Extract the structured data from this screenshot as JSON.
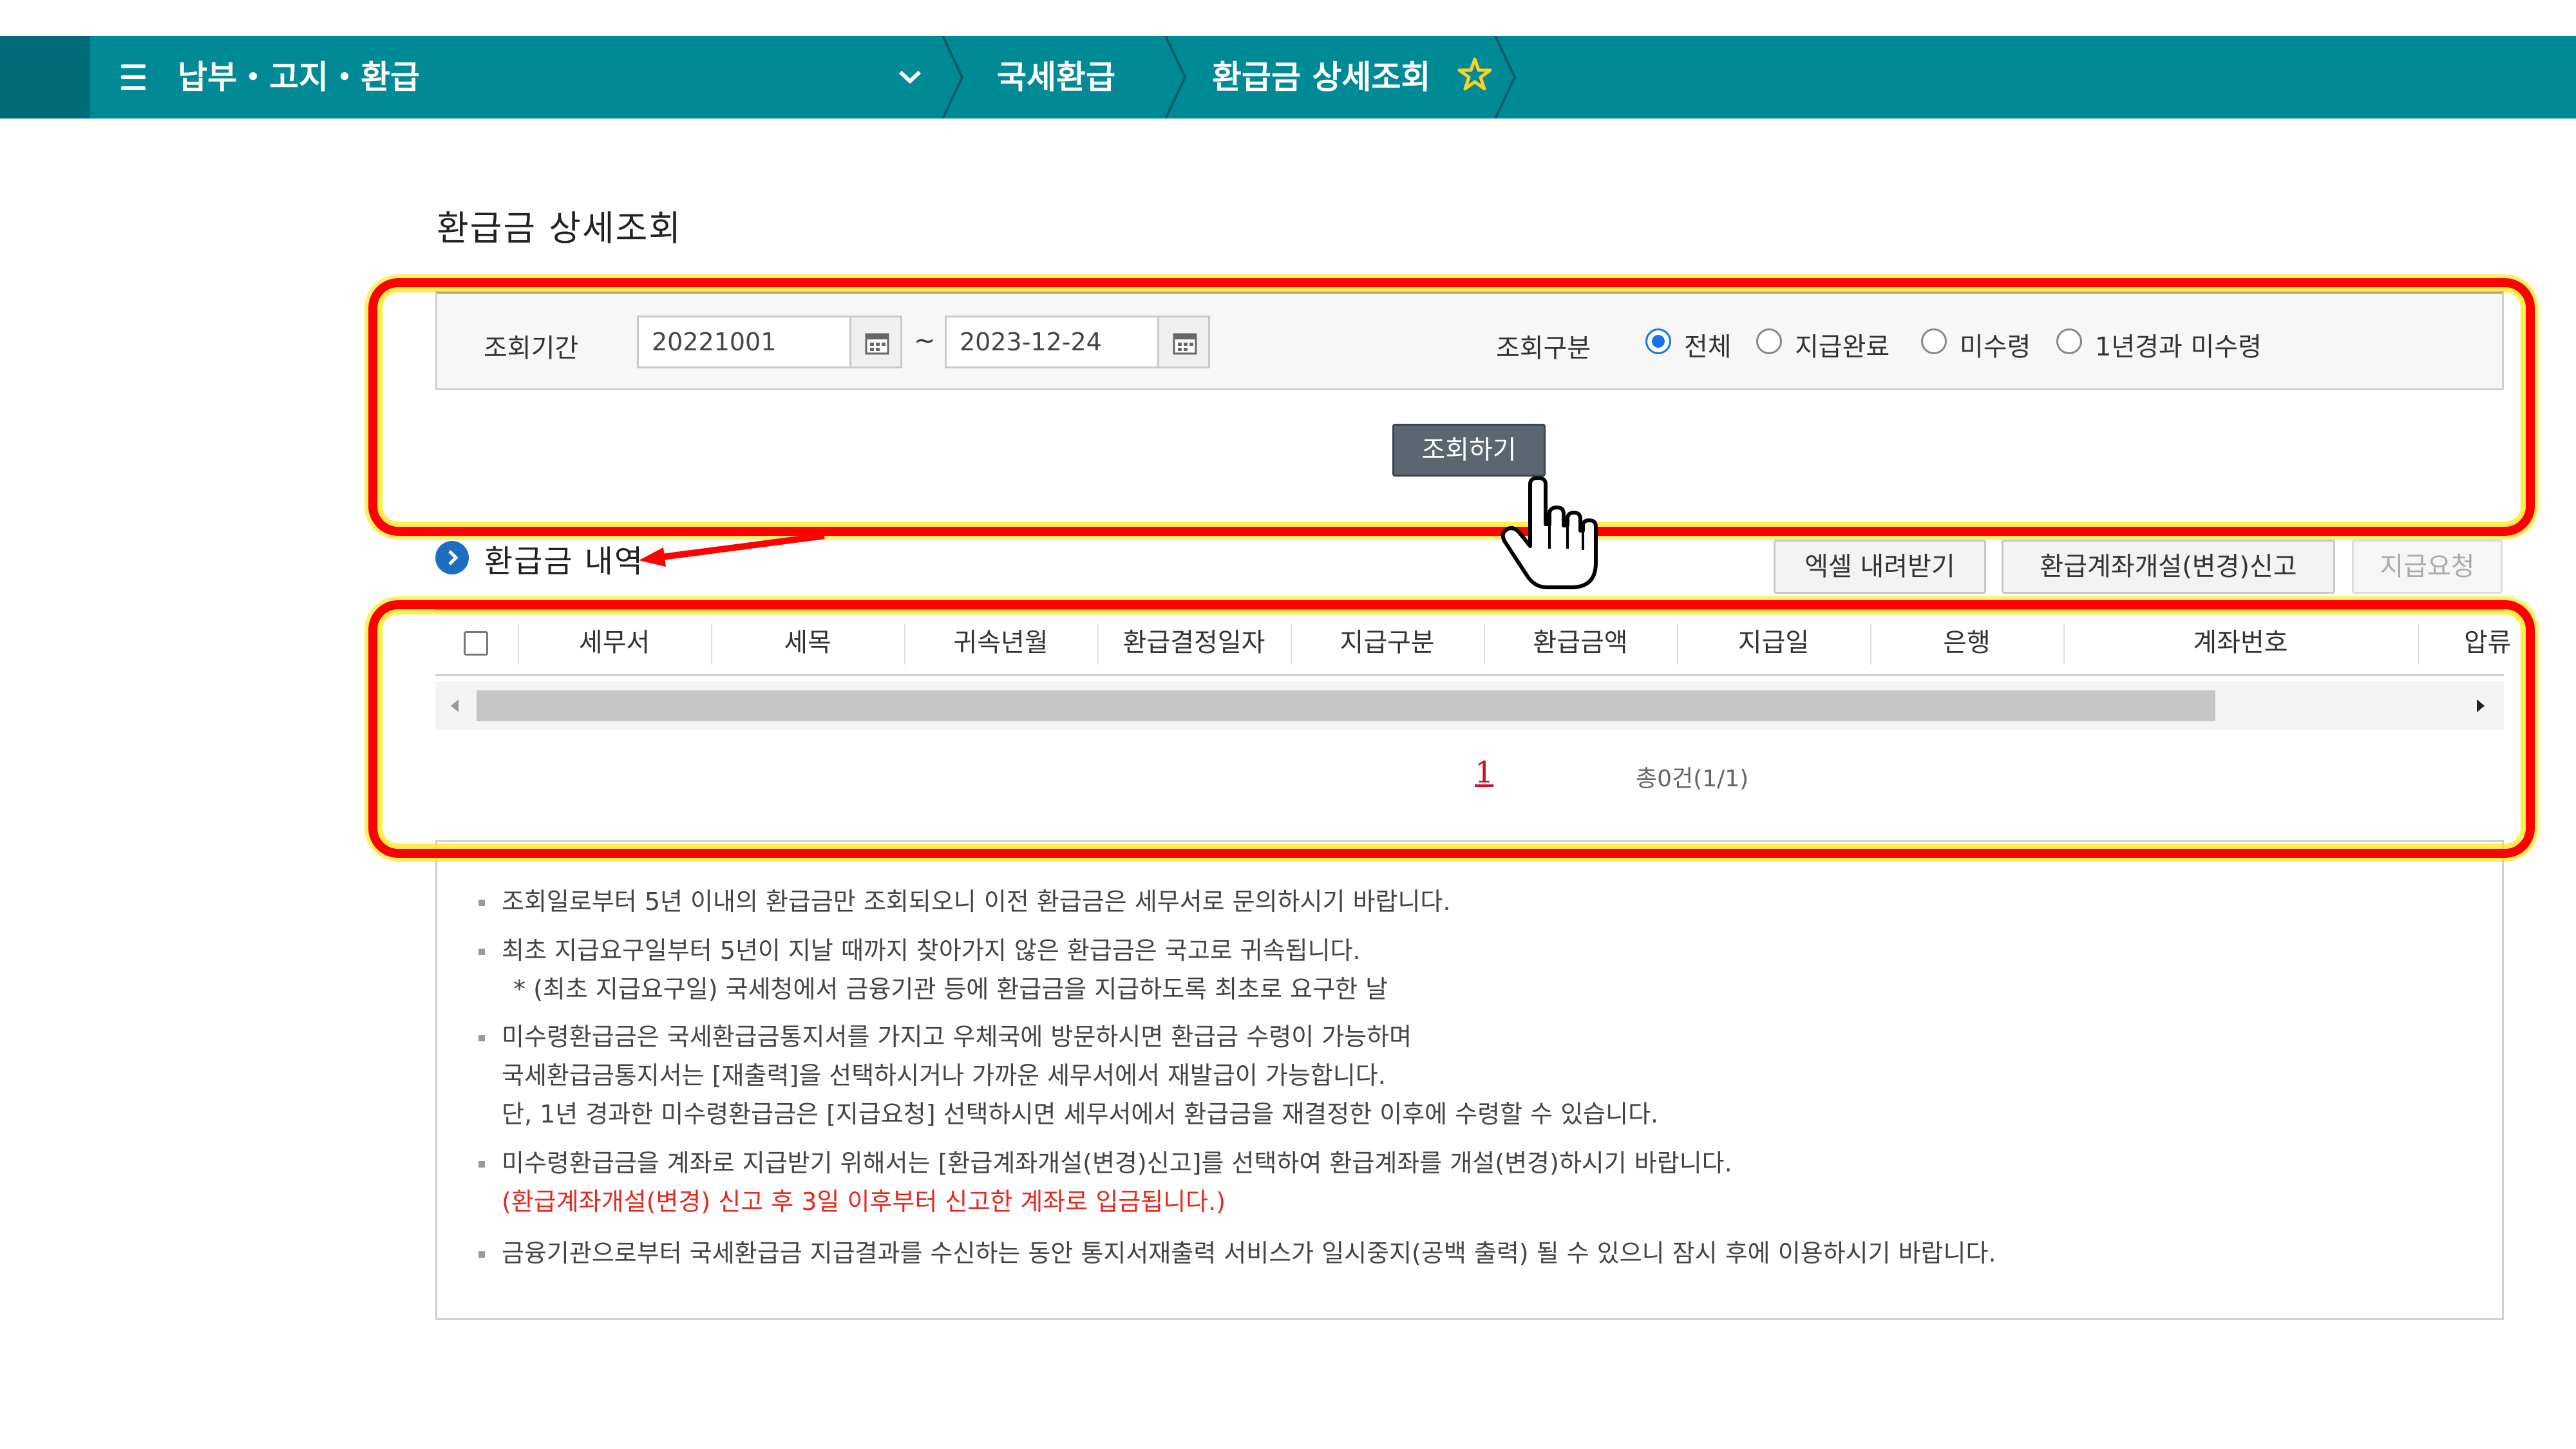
{
  "nav": {
    "menu": "납부・고지・환급",
    "crumb1": "국세환급",
    "crumb2": "환급금 상세조회"
  },
  "page": {
    "title": "환급금 상세조회"
  },
  "search": {
    "period_label": "조회기간",
    "start_date": "20221001",
    "tilde": "~",
    "end_date": "2023-12-24",
    "type_label": "조회구분",
    "options": [
      "전체",
      "지급완료",
      "미수령",
      "1년경과 미수령"
    ],
    "selected": "전체",
    "button": "조회하기"
  },
  "list": {
    "title": "환급금 내역",
    "buttons": {
      "excel": "엑셀 내려받기",
      "account": "환급계좌개설(변경)신고",
      "request": "지급요청"
    },
    "columns": [
      "세무서",
      "세목",
      "귀속년월",
      "환급결정일자",
      "지급구분",
      "환급금액",
      "지급일",
      "은행",
      "계좌번호",
      "압류"
    ],
    "pager": {
      "current": "1",
      "total": "총0건(1/1)"
    }
  },
  "notice": {
    "items": [
      [
        "조회일로부터 5년 이내의 환급금만 조회되오니 이전 환급금은 세무서로 문의하시기 바랍니다."
      ],
      [
        "최초 지급요구일부터 5년이 지날 때까지 찾아가지 않은 환급금은 국고로 귀속됩니다.",
        "* (최초 지급요구일) 국세청에서 금융기관 등에 환급금을 지급하도록 최초로 요구한 날"
      ],
      [
        "미수령환급금은 국세환급금통지서를 가지고 우체국에 방문하시면 환급금 수령이 가능하며",
        "국세환급금통지서는 [재출력]을 선택하시거나 가까운 세무서에서 재발급이 가능합니다.",
        "단, 1년 경과한 미수령환급금은 [지급요청] 선택하시면 세무서에서 환급금을 재결정한 이후에 수령할 수 있습니다."
      ],
      [
        "미수령환급금을 계좌로 지급받기 위해서는 [환급계좌개설(변경)신고]를 선택하여 환급계좌를 개설(변경)하시기 바랍니다.",
        "(환급계좌개설(변경) 신고 후 3일 이후부터 신고한 계좌로 입금됩니다.)"
      ],
      [
        "금융기관으로부터 국세환급금 지급결과를 수신하는 동안 통지서재출력 서비스가 일시중지(공백 출력) 될 수 있으니 잠시 후에 이용하시기 바랍니다."
      ]
    ]
  },
  "colors": {
    "nav": "#008a96",
    "highlight": "#ff0000",
    "radio": "#1a73e8",
    "warn": "#e8281e"
  }
}
